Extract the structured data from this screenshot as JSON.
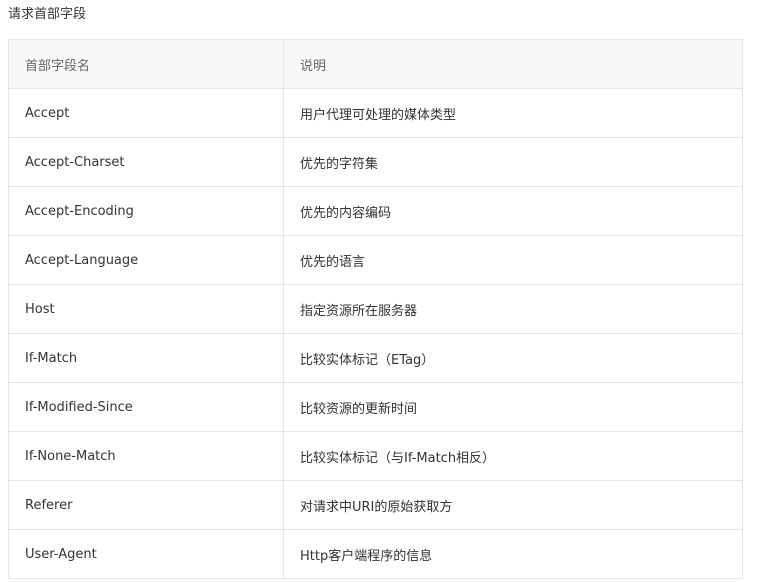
{
  "caption": "请求首部字段",
  "table": {
    "headers": [
      "首部字段名",
      "说明"
    ],
    "rows": [
      [
        "Accept",
        "用户代理可处理的媒体类型"
      ],
      [
        "Accept-Charset",
        "优先的字符集"
      ],
      [
        "Accept-Encoding",
        "优先的内容编码"
      ],
      [
        "Accept-Language",
        "优先的语言"
      ],
      [
        "Host",
        "指定资源所在服务器"
      ],
      [
        "If-Match",
        "比较实体标记（ETag）"
      ],
      [
        "If-Modified-Since",
        "比较资源的更新时间"
      ],
      [
        "If-None-Match",
        "比较实体标记（与If-Match相反）"
      ],
      [
        "Referer",
        "对请求中URI的原始获取方"
      ],
      [
        "User-Agent",
        "Http客户端程序的信息"
      ]
    ]
  }
}
